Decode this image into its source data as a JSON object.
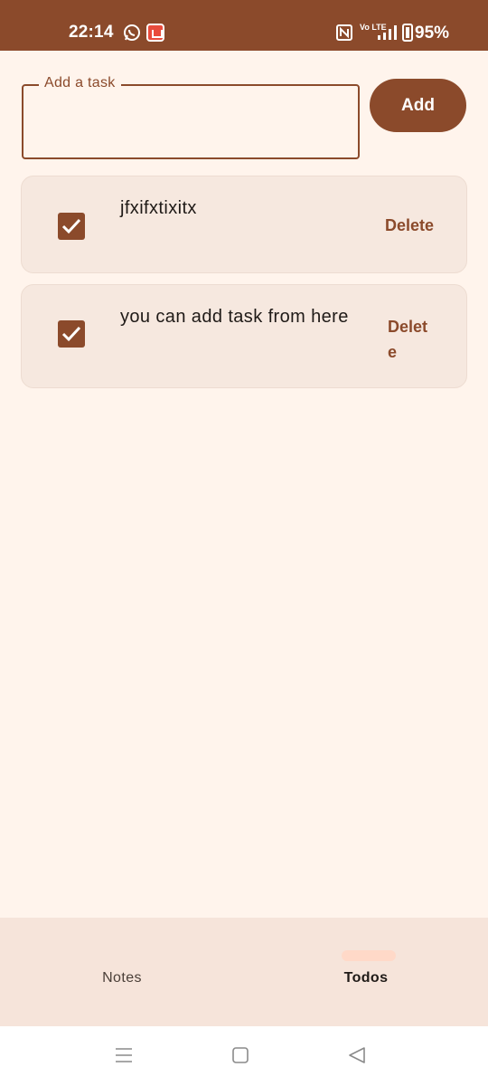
{
  "status_bar": {
    "time": "22:14",
    "battery_percent": "95%",
    "volte": "Vo LTE",
    "icons": [
      "whatsapp-icon",
      "app-notification-icon",
      "nfc-icon",
      "volte-icon",
      "signal-icon",
      "battery-icon"
    ]
  },
  "task_input": {
    "label": "Add a task",
    "value": "",
    "placeholder": ""
  },
  "add_button": {
    "label": "Add"
  },
  "tasks": [
    {
      "text": "jfxifxtixitx",
      "checked": true,
      "delete_label": "Delete"
    },
    {
      "text": "you can add task from here",
      "checked": true,
      "delete_label": "Delete"
    }
  ],
  "bottom_nav": {
    "tabs": [
      {
        "label": "Notes",
        "active": false
      },
      {
        "label": "Todos",
        "active": true
      }
    ]
  },
  "colors": {
    "primary": "#8b4a2b",
    "background": "#fff4ec",
    "card": "#f6e8df",
    "nav_background": "#f6e4da",
    "nav_indicator": "#ffd9c8"
  }
}
